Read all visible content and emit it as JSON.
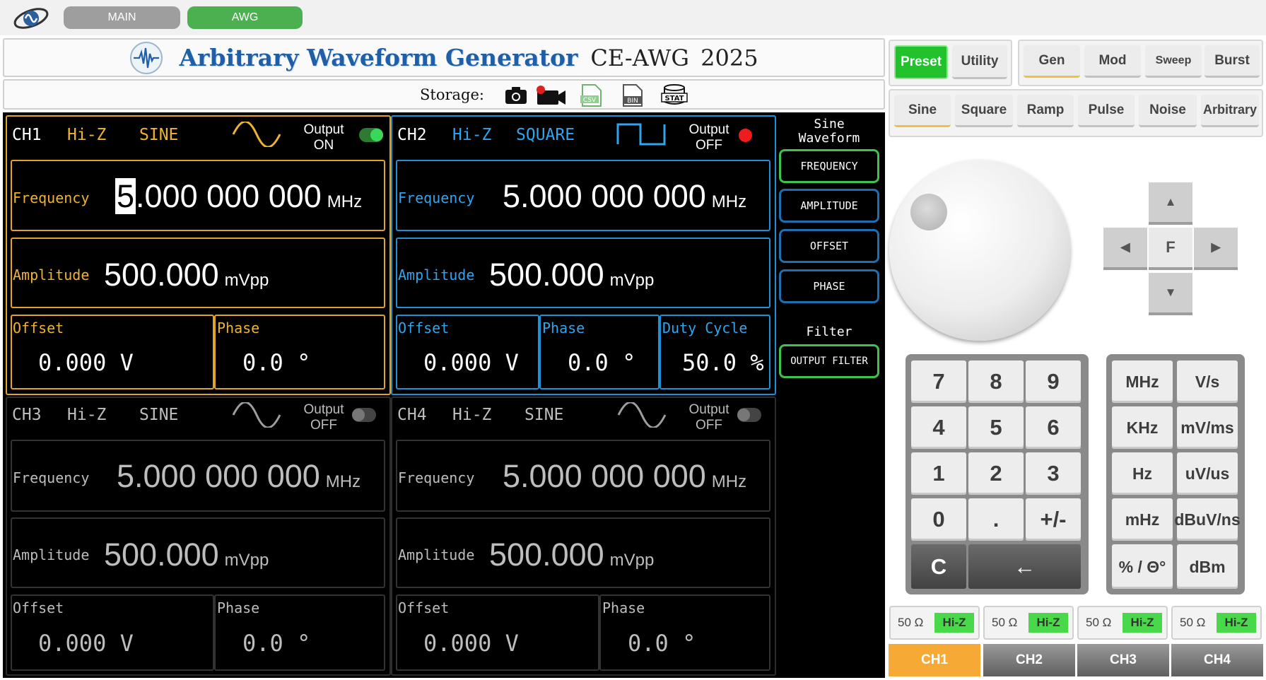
{
  "topbar": {
    "main_label": "MAIN",
    "awg_label": "AWG"
  },
  "header": {
    "title": "Arbitrary Waveform Generator",
    "model": "CE-AWG  2025"
  },
  "storage": {
    "label": "Storage:",
    "icons": [
      "camera-icon",
      "video-record-icon",
      "csv-file-icon",
      "bin-file-icon",
      "stat-icon"
    ],
    "csv": "CSV",
    "bin": "BIN",
    "stat": "STAT"
  },
  "channels": [
    {
      "name": "CH1",
      "impedance": "Hi-Z",
      "waveform": "SINE",
      "output_label": "Output",
      "output_state": "ON",
      "frequency_label": "Frequency",
      "frequency_cursor": "5",
      "frequency_rest": ".000 000 000",
      "frequency_unit": "MHz",
      "amplitude_label": "Amplitude",
      "amplitude_value": "500.000",
      "amplitude_unit": "mVpp",
      "offset_label": "Offset",
      "offset_value": "0.000 V",
      "phase_label": "Phase",
      "phase_value": "0.0 °"
    },
    {
      "name": "CH2",
      "impedance": "Hi-Z",
      "waveform": "SQUARE",
      "output_label": "Output",
      "output_state": "OFF",
      "frequency_label": "Frequency",
      "frequency_value": "5.000 000 000",
      "frequency_unit": "MHz",
      "amplitude_label": "Amplitude",
      "amplitude_value": "500.000",
      "amplitude_unit": "mVpp",
      "offset_label": "Offset",
      "offset_value": "0.000 V",
      "phase_label": "Phase",
      "phase_value": "0.0 °",
      "duty_label": "Duty Cycle",
      "duty_value": "50.0 %"
    },
    {
      "name": "CH3",
      "impedance": "Hi-Z",
      "waveform": "SINE",
      "output_label": "Output",
      "output_state": "OFF",
      "frequency_label": "Frequency",
      "frequency_value": "5.000 000 000",
      "frequency_unit": "MHz",
      "amplitude_label": "Amplitude",
      "amplitude_value": "500.000",
      "amplitude_unit": "mVpp",
      "offset_label": "Offset",
      "offset_value": "0.000 V",
      "phase_label": "Phase",
      "phase_value": "0.0 °"
    },
    {
      "name": "CH4",
      "impedance": "Hi-Z",
      "waveform": "SINE",
      "output_label": "Output",
      "output_state": "OFF",
      "frequency_label": "Frequency",
      "frequency_value": "5.000 000 000",
      "frequency_unit": "MHz",
      "amplitude_label": "Amplitude",
      "amplitude_value": "500.000",
      "amplitude_unit": "mVpp",
      "offset_label": "Offset",
      "offset_value": "0.000 V",
      "phase_label": "Phase",
      "phase_value": "0.0 °"
    }
  ],
  "side": {
    "waveform_title_1": "Sine",
    "waveform_title_2": "Waveform",
    "buttons": [
      "FREQUENCY",
      "AMPLITUDE",
      "OFFSET",
      "PHASE"
    ],
    "filter_title": "Filter",
    "filter_button": "OUTPUT FILTER"
  },
  "mode_tabs": {
    "preset": "Preset",
    "utility": "Utility",
    "gen": "Gen",
    "mod": "Mod",
    "sweep": "Sweep",
    "burst": "Burst"
  },
  "wave_tabs": [
    "Sine",
    "Square",
    "Ramp",
    "Pulse",
    "Noise",
    "Arbitrary"
  ],
  "nav": {
    "center": "F",
    "up": "▲",
    "down": "▼",
    "left": "◀",
    "right": "▶"
  },
  "keypad": [
    "7",
    "8",
    "9",
    "4",
    "5",
    "6",
    "1",
    "2",
    "3",
    "0",
    ".",
    "+/-"
  ],
  "keypad_clear": "C",
  "keypad_back": "←",
  "units": [
    "MHz",
    "V/s",
    "KHz",
    "mV/ms",
    "Hz",
    "uV/us",
    "mHz",
    "dBuV/ns",
    "% / Θ°",
    "dBm"
  ],
  "impedance_buttons": [
    {
      "ohm": "50 Ω",
      "hiz": "Hi-Z"
    },
    {
      "ohm": "50 Ω",
      "hiz": "Hi-Z"
    },
    {
      "ohm": "50 Ω",
      "hiz": "Hi-Z"
    },
    {
      "ohm": "50 Ω",
      "hiz": "Hi-Z"
    }
  ],
  "channel_select": [
    "CH1",
    "CH2",
    "CH3",
    "CH4"
  ],
  "colors": {
    "ch1": "#f0b330",
    "ch2": "#31a4ee",
    "active_green": "#22c22c",
    "active_channel": "#f6a935"
  }
}
